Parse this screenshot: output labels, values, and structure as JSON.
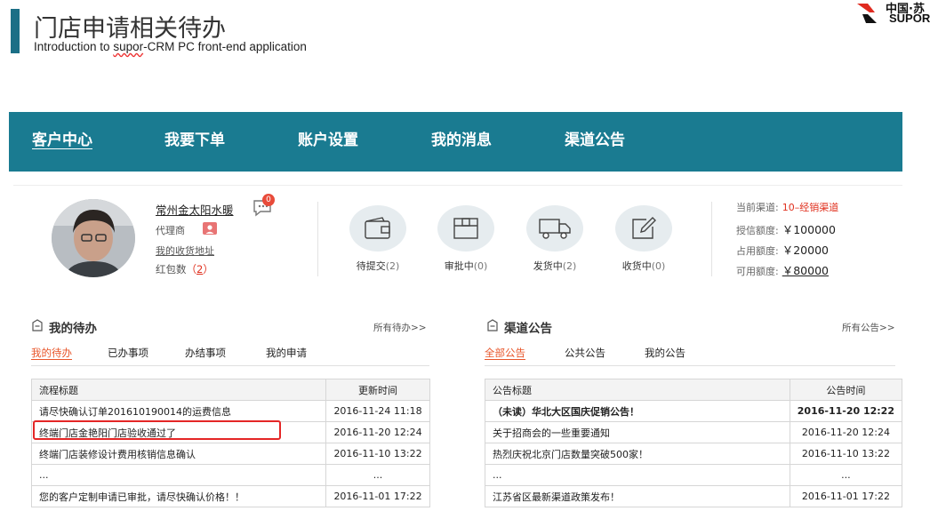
{
  "slide": {
    "title": "门店申请相关待办",
    "subtitle_prefix": "Introduction to ",
    "subtitle_brand": "supor",
    "subtitle_suffix": "-CRM PC front-end application"
  },
  "brand": {
    "cn": "中国·苏",
    "en": "SUPOR"
  },
  "nav": {
    "items": [
      {
        "label": "客户中心",
        "active": true
      },
      {
        "label": "我要下单"
      },
      {
        "label": "账户设置"
      },
      {
        "label": "我的消息"
      },
      {
        "label": "渠道公告"
      }
    ]
  },
  "profile": {
    "name": "常州金太阳水暖",
    "message_count": "0",
    "role": "代理商",
    "address_link": "我的收货地址",
    "redpack_label": "红包数",
    "redpack_open": "（",
    "redpack_count": "2",
    "redpack_close": "）"
  },
  "orders": [
    {
      "label": "待提交",
      "count": "(2)",
      "icon": "wallet-icon"
    },
    {
      "label": "审批中",
      "count": "(0)",
      "icon": "box-icon"
    },
    {
      "label": "发货中",
      "count": "(2)",
      "icon": "truck-icon"
    },
    {
      "label": "收货中",
      "count": "(0)",
      "icon": "edit-icon"
    }
  ],
  "credit": {
    "channel_label": "当前渠道:",
    "channel_value": "10–经销渠道",
    "granted_label": "授信额度:",
    "granted_value": "￥100000",
    "used_label": "占用额度:",
    "used_value": "￥20000",
    "available_label": "可用额度:",
    "available_value": "￥80000"
  },
  "todo_panel": {
    "title": "我的待办",
    "more": "所有待办>>",
    "tabs": [
      "我的待办",
      "已办事项",
      "办结事项",
      "我的申请"
    ],
    "columns": [
      "流程标题",
      "更新时间"
    ],
    "rows": [
      {
        "title": "请尽快确认订单201610190014的运费信息",
        "time": "2016-11-24 11:18"
      },
      {
        "title": "终端门店金艳阳门店验收通过了",
        "time": "2016-11-20 12:24"
      },
      {
        "title": "终端门店装修设计费用核销信息确认",
        "time": "2016-11-10 13:22"
      },
      {
        "title": "...",
        "time": "..."
      },
      {
        "title": "您的客户定制申请已审批，请尽快确认价格！！",
        "time": "2016-11-01 17:22"
      }
    ]
  },
  "notice_panel": {
    "title": "渠道公告",
    "more": "所有公告>>",
    "tabs": [
      "全部公告",
      "公共公告",
      "我的公告"
    ],
    "columns": [
      "公告标题",
      "公告时间"
    ],
    "rows": [
      {
        "title": "（未读）华北大区国庆促销公告！",
        "time": "2016-11-20 12:22",
        "unread": true
      },
      {
        "title": "关于招商会的一些重要通知",
        "time": "2016-11-20 12:24"
      },
      {
        "title": "热烈庆祝北京门店数量突破500家！",
        "time": "2016-11-10 13:22"
      },
      {
        "title": "...",
        "time": "..."
      },
      {
        "title": "江苏省区最新渠道政策发布！",
        "time": "2016-11-01 17:22"
      }
    ]
  },
  "colors": {
    "nav_bg": "#1a7b91",
    "accent": "#e8552a",
    "alert": "#e42626"
  }
}
